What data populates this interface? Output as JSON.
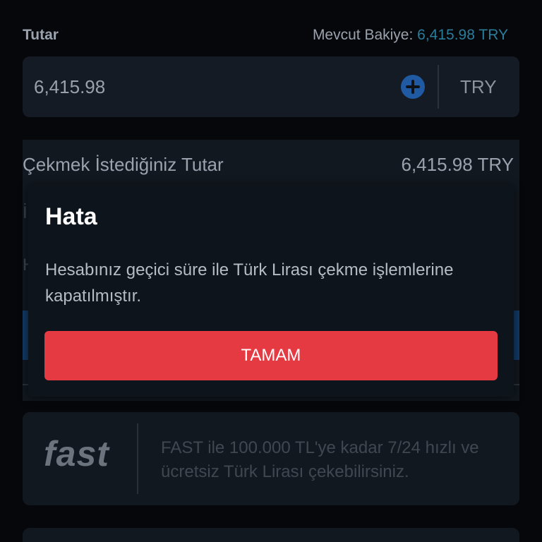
{
  "amount_section": {
    "label": "Tutar",
    "balance_label": "Mevcut Bakiye:",
    "balance_value": "6,415.98 TRY",
    "amount_value": "6,415.98",
    "currency": "TRY",
    "plus_icon": "plus-circle-icon"
  },
  "summary": {
    "label": "Çekmek İstediğiniz Tutar",
    "value": "6,415.98 TRY",
    "partial_row_1": "İ",
    "partial_row_2": "H"
  },
  "fast_info": {
    "logo_text": "fast",
    "text": "FAST ile 100.000 TL'ye kadar 7/24 hızlı ve ücretsiz Türk Lirası çekebilirsiniz."
  },
  "dialog": {
    "title": "Hata",
    "message": "Hesabınız geçici süre ile Türk Lirası çekme işlemlerine kapatılmıştır.",
    "ok_label": "TAMAM"
  },
  "colors": {
    "background": "#05070b",
    "accent_balance": "#2a7d9a",
    "button_red": "#e63a42",
    "plus_blue": "#1f5aa3"
  }
}
